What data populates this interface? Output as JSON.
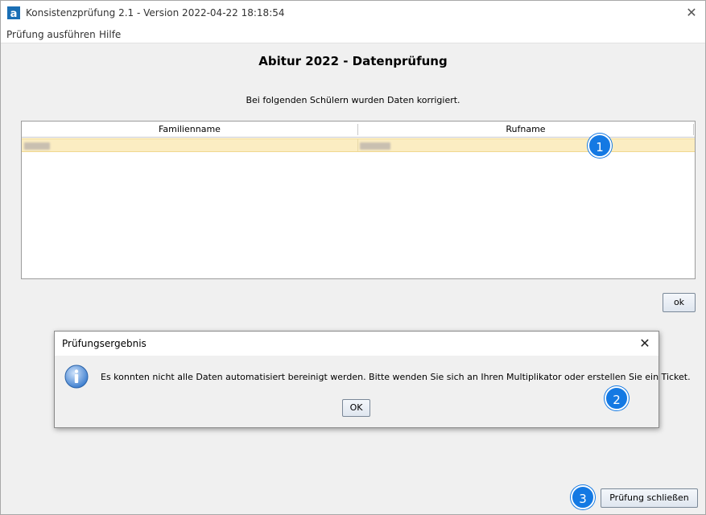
{
  "window": {
    "title": "Konsistenzprüfung 2.1 - Version 2022-04-22 18:18:54",
    "app_icon": "app-logo-icon",
    "close_icon": "close-icon"
  },
  "menu": {
    "items": [
      {
        "label": "Prüfung ausführen"
      },
      {
        "label": "Hilfe"
      }
    ]
  },
  "main": {
    "title": "Abitur 2022 - Datenprüfung",
    "subtitle": "Bei folgenden Schülern wurden Daten korrigiert.",
    "table": {
      "columns": [
        "Familienname",
        "Rufname"
      ],
      "rows": [
        {
          "familienname": "",
          "rufname": "",
          "selected": true,
          "redacted": true
        }
      ]
    },
    "ok_button_label": "ok",
    "close_button_label": "Prüfung schließen"
  },
  "dialog": {
    "title": "Prüfungsergebnis",
    "message": "Es konnten nicht alle Daten automatisiert bereinigt werden. Bitte wenden Sie sich an Ihren Multiplikator oder erstellen Sie ein Ticket.",
    "ok_label": "OK",
    "icon": "info-icon"
  },
  "annotations": {
    "badges": [
      "1",
      "2",
      "3"
    ],
    "badge_color": "#1479e3"
  },
  "colors": {
    "selected_row": "#fbedc2",
    "window_bg": "#f0f0f0"
  }
}
